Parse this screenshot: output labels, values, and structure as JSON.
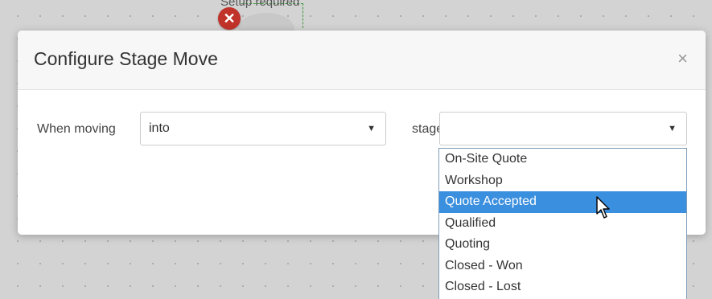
{
  "background": {
    "node_label": "Setup required",
    "delete_symbol": "✕"
  },
  "modal": {
    "title": "Configure Stage Move",
    "close_symbol": "×",
    "when_moving_label": "When moving",
    "direction_select": {
      "value": "into",
      "caret": "▼"
    },
    "stage_label": "stage",
    "stage_select": {
      "value": "",
      "caret": "▼"
    }
  },
  "stage_dropdown": {
    "options": [
      "On-Site Quote",
      "Workshop",
      "Quote Accepted",
      "Qualified",
      "Quoting",
      "Closed - Won",
      "Closed - Lost"
    ],
    "highlighted": "Quote Accepted"
  },
  "colors": {
    "highlight": "#3b8fdf",
    "delete_badge": "#c0322a",
    "canvas": "#d3d3d3"
  },
  "icons": {
    "cursor": "mouse-pointer-icon",
    "delete": "close-icon"
  }
}
